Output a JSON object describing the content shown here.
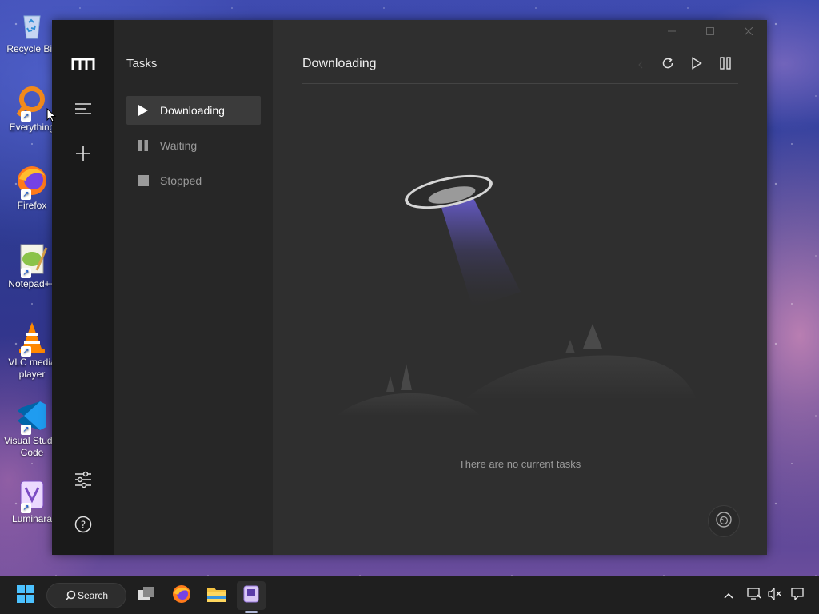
{
  "desktop": {
    "icons": [
      {
        "label": "Recycle Bin",
        "icon": "recycle-bin-icon"
      },
      {
        "label": "Everything",
        "icon": "everything-search-icon"
      },
      {
        "label": "Firefox",
        "icon": "firefox-icon"
      },
      {
        "label": "Notepad++",
        "icon": "notepad-plus-plus-icon"
      },
      {
        "label": "VLC media player",
        "icon": "vlc-icon"
      },
      {
        "label": "Visual Studio Code",
        "icon": "vscode-icon"
      },
      {
        "label": "Luminara",
        "icon": "luminara-icon"
      }
    ]
  },
  "app": {
    "sidebar_icons": [
      "motrix-logo-icon",
      "menu-icon",
      "add-icon",
      "settings-sliders-icon",
      "help-icon"
    ],
    "tasks_panel": {
      "title": "Tasks",
      "items": [
        {
          "label": "Downloading",
          "icon": "play-icon",
          "active": true
        },
        {
          "label": "Waiting",
          "icon": "pause-icon",
          "active": false
        },
        {
          "label": "Stopped",
          "icon": "stop-icon",
          "active": false
        }
      ]
    },
    "content": {
      "title": "Downloading",
      "toolbar_icons": [
        "refresh-icon",
        "resume-all-icon",
        "pause-all-icon"
      ],
      "empty_message": "There are no current tasks"
    },
    "window_controls": [
      "minimize",
      "maximize",
      "close"
    ]
  },
  "taskbar": {
    "search_label": "Search",
    "pinned": [
      "start-icon",
      "task-view-icon",
      "firefox-icon",
      "file-explorer-icon",
      "motrix-app-icon"
    ],
    "tray_icons": [
      "chevron-up-icon",
      "network-icon",
      "volume-muted-icon",
      "notification-icon"
    ]
  }
}
